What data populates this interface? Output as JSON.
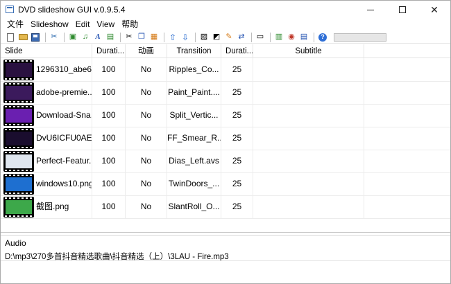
{
  "window": {
    "title": "DVD slideshow GUI v.0.9.5.4",
    "controls": {
      "minimize": "—",
      "maximize": "☐",
      "close": "✕"
    }
  },
  "menu": [
    "文件",
    "Slideshow",
    "Edit",
    "View",
    "帮助"
  ],
  "toolbar": {
    "icons": [
      "new-document-icon",
      "open-folder-icon",
      "save-icon",
      "scissors-tools-icon",
      "add-image-icon",
      "add-audio-icon",
      "add-text-icon",
      "add-background-icon",
      "cut-icon",
      "copy-icon",
      "paste-icon",
      "move-up-icon",
      "move-down-icon",
      "image-edit-icon",
      "image-adjust-icon",
      "brush-icon",
      "swap-icon",
      "presentation-icon",
      "export-icon",
      "disc-icon",
      "burn-icon",
      "help-icon"
    ],
    "progress": 0
  },
  "table": {
    "columns": [
      "Slide",
      "Durati...",
      "动画",
      "Transition",
      "Durati...",
      "Subtitle"
    ],
    "rows": [
      {
        "name": "1296310_abe6...",
        "duration": "100",
        "anim": "No",
        "transition": "Ripples_Co...",
        "tduration": "25",
        "subtitle": "",
        "thumb_color": "#2a1140"
      },
      {
        "name": "adobe-premie...",
        "duration": "100",
        "anim": "No",
        "transition": "Paint_Paint....",
        "tduration": "25",
        "subtitle": "",
        "thumb_color": "#3b1a5c"
      },
      {
        "name": "Download-Sna...",
        "duration": "100",
        "anim": "No",
        "transition": "Split_Vertic...",
        "tduration": "25",
        "subtitle": "",
        "thumb_color": "#6a1fb0"
      },
      {
        "name": "DvU6ICFU0AE...",
        "duration": "100",
        "anim": "No",
        "transition": "FF_Smear_R...",
        "tduration": "25",
        "subtitle": "",
        "thumb_color": "#1a0d2e"
      },
      {
        "name": "Perfect-Featur...",
        "duration": "100",
        "anim": "No",
        "transition": "Dias_Left.avs",
        "tduration": "25",
        "subtitle": "",
        "thumb_color": "#dfe6ef"
      },
      {
        "name": "windows10.png",
        "duration": "100",
        "anim": "No",
        "transition": "TwinDoors_...",
        "tduration": "25",
        "subtitle": "",
        "thumb_color": "#1e6fd0"
      },
      {
        "name": "截图.png",
        "duration": "100",
        "anim": "No",
        "transition": "SlantRoll_O...",
        "tduration": "25",
        "subtitle": "",
        "thumb_color": "#3da84a"
      }
    ]
  },
  "audio": {
    "label": "Audio",
    "path": "D:\\mp3\\270多首抖音精选歌曲\\抖音精选（上）\\3LAU - Fire.mp3"
  }
}
